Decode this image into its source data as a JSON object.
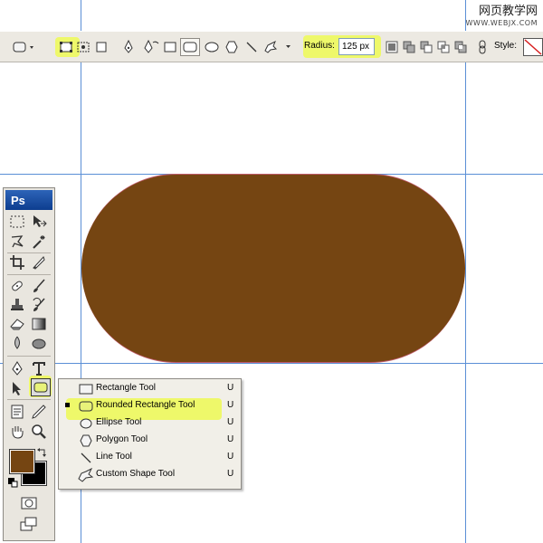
{
  "watermark": {
    "line1": "网页教学网",
    "line2": "WWW.WEBJX.COM"
  },
  "options_bar": {
    "radius_label": "Radius:",
    "radius_value": "125 px",
    "style_label": "Style:",
    "icons": [
      "rounded-rect-preset-icon",
      "shape-layers-icon",
      "paths-icon",
      "fill-pixels-icon",
      "pen-icon",
      "freeform-pen-icon",
      "rectangle-icon",
      "rounded-rectangle-icon",
      "ellipse-icon",
      "polygon-icon",
      "line-icon",
      "custom-shape-icon",
      "new-shape-layer-icon",
      "add-to-area-icon",
      "subtract-area-icon",
      "intersect-area-icon",
      "exclude-overlap-icon",
      "link-icon",
      "style-swatch-icon"
    ]
  },
  "canvas": {
    "shape_color": "#754512"
  },
  "toolbox": {
    "logo": "Ps",
    "foreground_color": "#754512",
    "background_color": "#000000"
  },
  "flyout": {
    "items": [
      {
        "label": "Rectangle Tool",
        "shortcut": "U",
        "icon": "rectangle-icon",
        "selected": false
      },
      {
        "label": "Rounded Rectangle Tool",
        "shortcut": "U",
        "icon": "rounded-rectangle-icon",
        "selected": true
      },
      {
        "label": "Ellipse Tool",
        "shortcut": "U",
        "icon": "ellipse-icon",
        "selected": false
      },
      {
        "label": "Polygon Tool",
        "shortcut": "U",
        "icon": "polygon-icon",
        "selected": false
      },
      {
        "label": "Line Tool",
        "shortcut": "U",
        "icon": "line-icon",
        "selected": false
      },
      {
        "label": "Custom Shape Tool",
        "shortcut": "U",
        "icon": "custom-shape-icon",
        "selected": false
      }
    ]
  },
  "colors": {
    "highlight": "#eef86a",
    "guide": "#5a8fd6",
    "selected_shape_fill": "#e8f27a"
  }
}
